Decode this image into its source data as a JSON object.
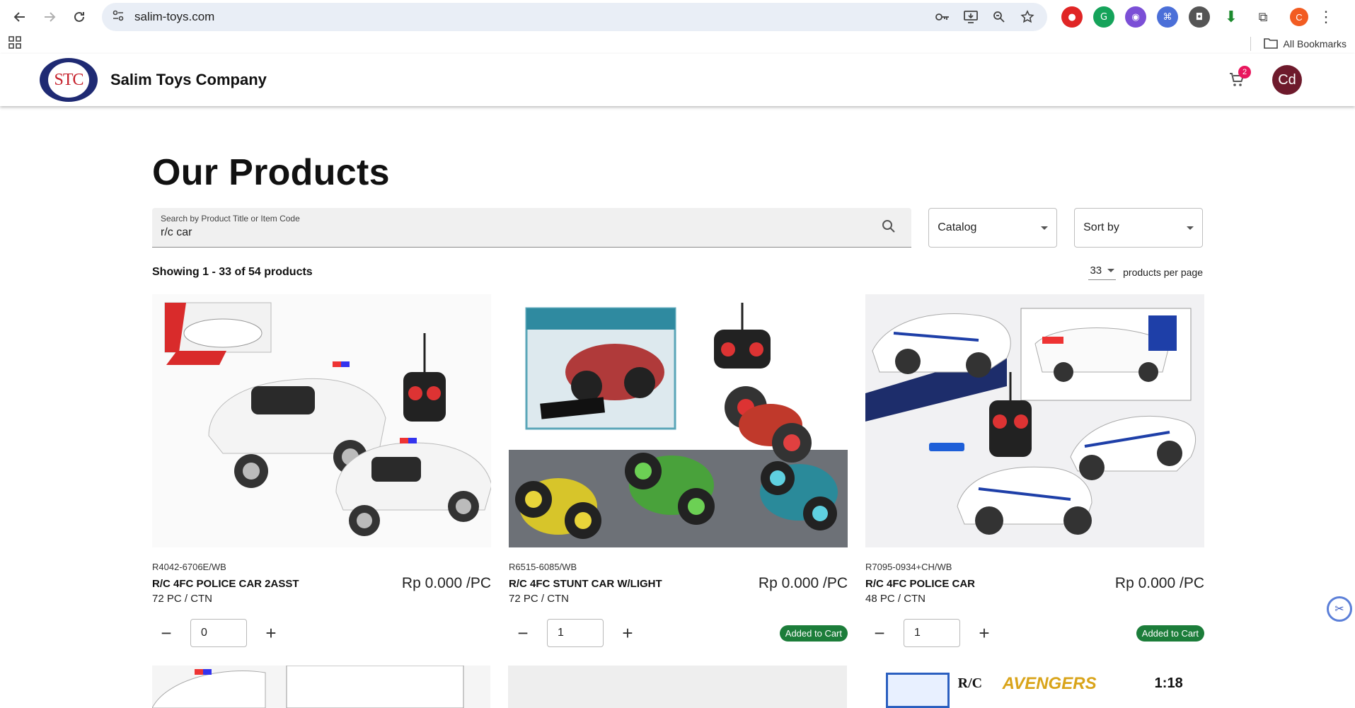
{
  "browser": {
    "url": "salim-toys.com",
    "bookmarks_label": "All Bookmarks",
    "profile_initial": "C"
  },
  "header": {
    "logo_text": "STC",
    "brand_name": "Salim Toys Company",
    "cart_count": "2",
    "avatar_initials": "Cd"
  },
  "main": {
    "title": "Our Products",
    "search": {
      "label": "Search by Product Title or Item Code",
      "value": "r/c car"
    },
    "catalog_label": "Catalog",
    "sort_label": "Sort by",
    "showing": "Showing 1 - 33 of 54 products",
    "per_page_value": "33",
    "per_page_label": "products per page"
  },
  "products": [
    {
      "code": "R4042-6706E/WB",
      "name": "R/C 4FC POLICE CAR 2ASST",
      "price": "Rp 0.000 /PC",
      "pack": "72 PC / CTN",
      "qty": "0",
      "added_label": ""
    },
    {
      "code": "R6515-6085/WB",
      "name": "R/C 4FC STUNT CAR W/LIGHT",
      "price": "Rp 0.000 /PC",
      "pack": "72 PC / CTN",
      "qty": "1",
      "added_label": "Added to Cart"
    },
    {
      "code": "R7095-0934+CH/WB",
      "name": "R/C 4FC POLICE CAR",
      "price": "Rp 0.000 /PC",
      "pack": "48 PC / CTN",
      "qty": "1",
      "added_label": "Added to Cart"
    }
  ],
  "row2_texts": {
    "c3_a": "R/C",
    "c3_b": "AVENGERS",
    "c3_c": "1:18"
  },
  "colors": {
    "brand_navy": "#1f2a73",
    "brand_red": "#c6202b",
    "cart_badge": "#e8175d",
    "added_green": "#1c7d3a",
    "avatar": "#6e1a2c"
  }
}
